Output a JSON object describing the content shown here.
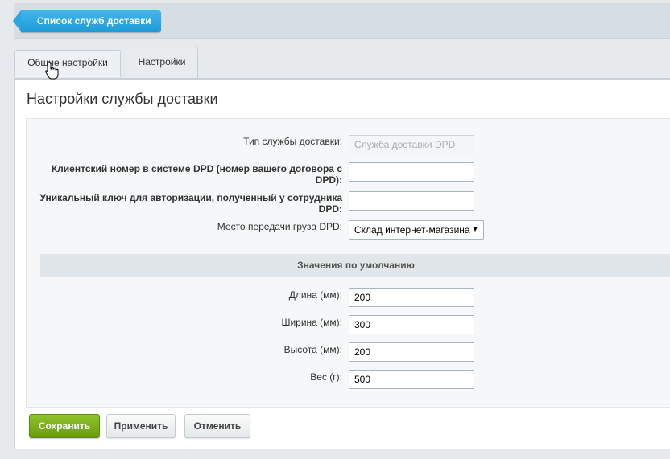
{
  "header": {
    "back_label": "Список служб доставки"
  },
  "tabs": [
    {
      "label": "Общие настройки"
    },
    {
      "label": "Настройки"
    }
  ],
  "panel": {
    "title": "Настройки службы доставки"
  },
  "form": {
    "type_label": "Тип службы доставки:",
    "type_placeholder": "Служба доставки DPD",
    "client_label": "Клиентский номер в системе DPD (номер вашего договора с DPD):",
    "client_value": "",
    "key_label": "Уникальный ключ для авторизации, полученный у сотрудника DPD:",
    "key_value": "",
    "place_label": "Место передачи груза DPD:",
    "place_value": "Склад интернет-магазина",
    "defaults_section": "Значения по умолчанию",
    "length_label": "Длина (мм):",
    "length_value": "200",
    "width_label": "Ширина (мм):",
    "width_value": "300",
    "height_label": "Высота (мм):",
    "height_value": "200",
    "weight_label": "Вес (г):",
    "weight_value": "500"
  },
  "buttons": {
    "save": "Сохранить",
    "apply": "Применить",
    "cancel": "Отменить"
  }
}
